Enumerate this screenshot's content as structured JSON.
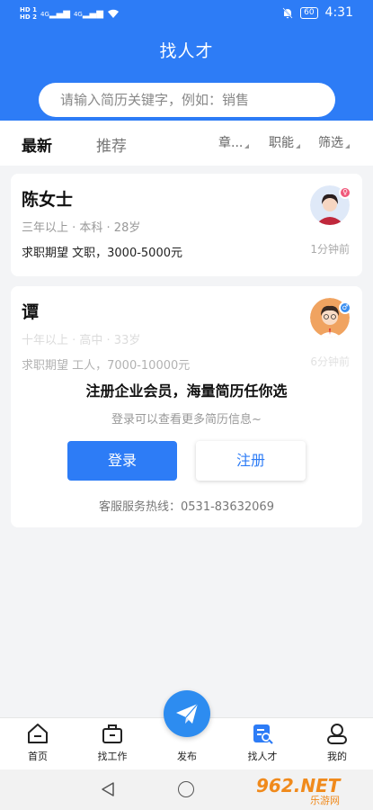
{
  "status": {
    "time": "4:31",
    "battery": "60",
    "hd1": "HD 1",
    "hd2": "HD 2",
    "net1": "4G",
    "net2": "4G"
  },
  "header": {
    "title": "找人才",
    "search_placeholder": "请输入简历关键字，例如：销售"
  },
  "tabs": {
    "latest": "最新",
    "recommend": "推荐"
  },
  "filters": [
    "章...",
    "职能",
    "筛选"
  ],
  "cards": [
    {
      "name": "陈女士",
      "meta": "三年以上 · 本科 · 28岁",
      "expect": "求职期望 文职，3000-5000元",
      "time": "1分钟前",
      "gender": "female"
    },
    {
      "name": "谭",
      "meta": "十年以上 · 高中 · 33岁",
      "expect": "求职期望 工人，7000-10000元",
      "time": "6分钟前",
      "gender": "male"
    }
  ],
  "prompt": {
    "title": "注册企业会员，海量简历任你选",
    "subtitle": "登录可以查看更多简历信息~",
    "login": "登录",
    "register": "注册",
    "hotline": "客服服务热线：0531-83632069"
  },
  "nav": {
    "home": "首页",
    "jobs": "找工作",
    "publish": "发布",
    "talent": "找人才",
    "mine": "我的"
  },
  "watermark": {
    "big": "962.NET",
    "small": "乐游网"
  },
  "colors": {
    "primary": "#2d7cf6",
    "female": "#f0577a",
    "male": "#3a8ef0"
  }
}
